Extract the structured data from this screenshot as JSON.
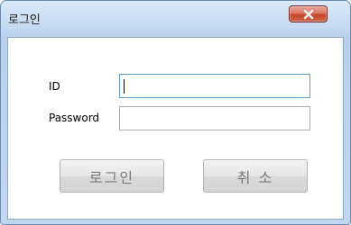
{
  "window": {
    "title": "로그인",
    "close_icon": "close-icon",
    "accent_close": "#c3442a"
  },
  "form": {
    "id_label": "ID",
    "id_value": "",
    "password_label": "Password",
    "password_value": ""
  },
  "buttons": {
    "login_label": "로그인",
    "cancel_label": "취 소"
  }
}
